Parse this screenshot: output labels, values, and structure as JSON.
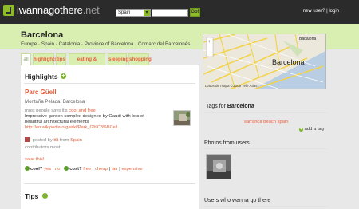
{
  "topbar": {
    "logo_main": "iwannagothere",
    "logo_tld": ".net",
    "country_select": "Spain",
    "search_placeholder": "",
    "go_label": "Go!",
    "link_new_user": "new user?",
    "link_separator": "|",
    "link_login": "login"
  },
  "header": {
    "title": "Barcelona",
    "breadcrumb": "Europe · Spain · Catalonia · Province of Barcelona · Comarc del Barcelonès"
  },
  "map": {
    "city_label": "Barcelona",
    "secondary_label": "Badalona",
    "copyright": "Datos de mapa ©2009 Tele Atlas"
  },
  "tabs": [
    {
      "label": "all",
      "active": true
    },
    {
      "label": "highlights",
      "active": false
    },
    {
      "label": "tips",
      "active": false
    },
    {
      "label": "eating & drinking",
      "active": false
    },
    {
      "label": "sleeping",
      "active": false
    },
    {
      "label": "shopping",
      "active": false
    }
  ],
  "highlights": {
    "title": "Highlights",
    "place": {
      "name": "Parc Güell",
      "location": "Montaña Pelada, Barcelona",
      "said_prefix": "most people says it's",
      "said_value": "cool and free",
      "description": "Impressive garden complex designed by Gaudi with lots of beautiful architectural elements",
      "url": "http://en.wikipedia.org/wiki/Park_G%C3%BCell",
      "posted_prefix": "posted by",
      "posted_user": "tilt",
      "posted_from_prefix": "from",
      "posted_from": "Spain",
      "contributors_label": "contributors",
      "contributors_value": "most",
      "save_label": "save this!",
      "cool_question": "cool?",
      "cool_yes": "yes",
      "cool_no": "no",
      "cost_question": "cost?",
      "cost_free": "free",
      "cost_cheap": "cheap",
      "cost_fair": "fair",
      "cost_expensive": "expensive",
      "sep": "|"
    }
  },
  "tips": {
    "title": "Tips"
  },
  "right": {
    "tags_prefix": "Tags for",
    "tags_city": "Barcelona",
    "tag_1": "sarranca beach spain",
    "add_tag": "add a tag",
    "photos_title": "Photos from users",
    "users_title": "Users who wanna go there"
  },
  "colors": {
    "accent": "#e8603c",
    "green": "#8dbb2c",
    "header_bg": "#d9eeb1",
    "topbar_bg": "#2b2b2b"
  }
}
